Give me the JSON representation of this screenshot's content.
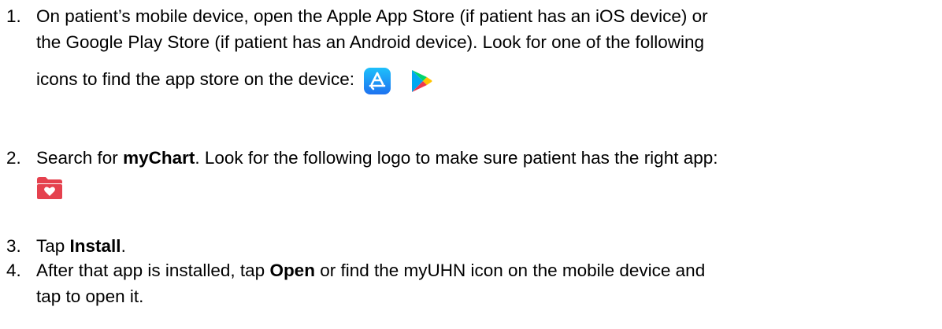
{
  "steps": [
    {
      "number": "1.",
      "line1": "On patient’s mobile device, open the Apple App Store (if patient has an iOS device) or",
      "line2": "the Google Play Store (if patient has an Android device). Look for one of the following",
      "line3": "icons to find the app store on the device:",
      "icons": [
        "app-store-icon",
        "google-play-icon"
      ]
    },
    {
      "number": "2.",
      "before_bold": "Search for ",
      "bold": "myChart",
      "after_bold": ". Look for the following logo to make sure patient has the right app:",
      "icon": "mychart-folder-heart-icon"
    },
    {
      "number": "3.",
      "before_bold": "Tap ",
      "bold": "Install",
      "after_bold": "."
    },
    {
      "number": "4.",
      "before_bold": "After that app is installed, tap ",
      "bold": "Open",
      "after_bold": " or find the myUHN icon on the mobile device and",
      "line2": "tap to open it."
    }
  ],
  "colors": {
    "app_store_blue": "#1e8cf0",
    "mychart_red": "#e5414e",
    "play_green": "#00d36f",
    "play_blue": "#00a8f0",
    "play_yellow": "#ffc400",
    "play_red": "#f0384c"
  }
}
